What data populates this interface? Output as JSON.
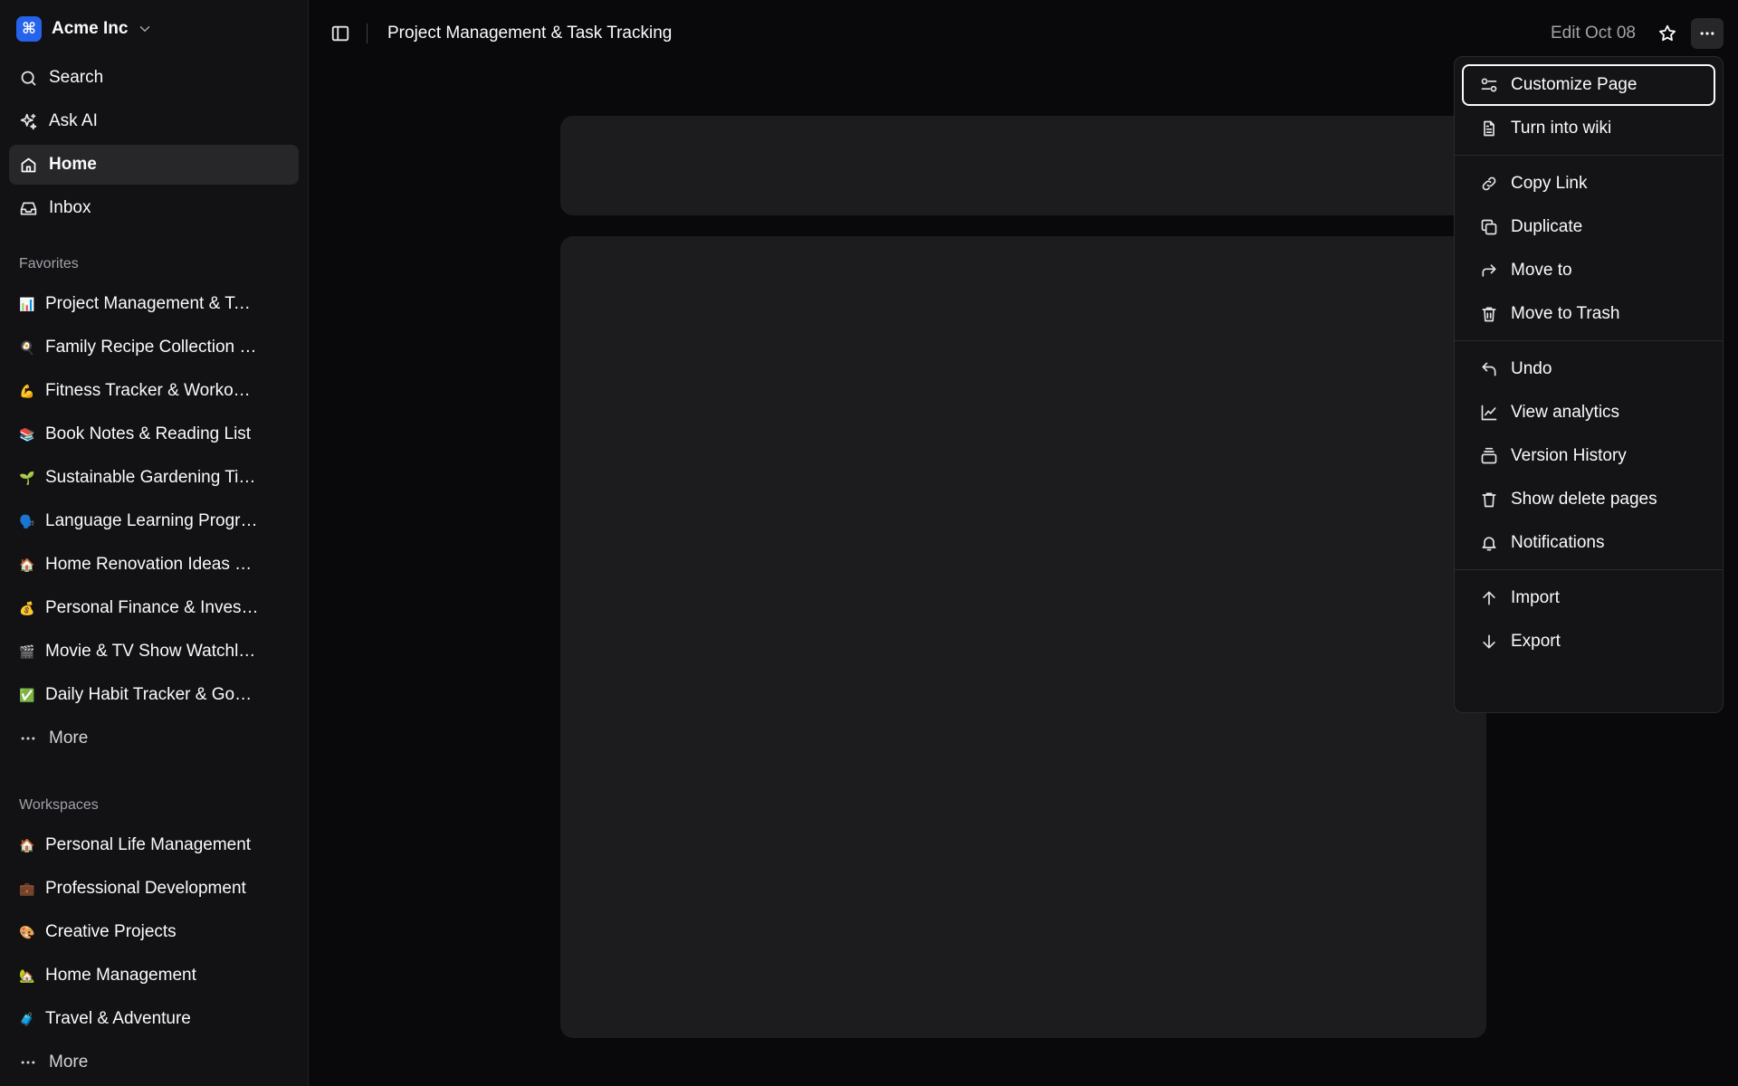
{
  "app": {
    "team_name": "Acme Inc",
    "team_logo_glyph": "⌘",
    "accent": "#2563eb"
  },
  "nav": [
    {
      "label": "Search",
      "icon": "search-icon"
    },
    {
      "label": "Ask AI",
      "icon": "sparkles-icon"
    },
    {
      "label": "Home",
      "icon": "home-icon",
      "active": true
    },
    {
      "label": "Inbox",
      "icon": "inbox-icon"
    }
  ],
  "favorites": {
    "title": "Favorites",
    "items": [
      {
        "emoji": "📊",
        "label": "Project Management & Task Tracking"
      },
      {
        "emoji": "🍳",
        "label": "Family Recipe Collection & Meal Planning"
      },
      {
        "emoji": "💪",
        "label": "Fitness Tracker & Workout Routines"
      },
      {
        "emoji": "📚",
        "label": "Book Notes & Reading List"
      },
      {
        "emoji": "🌱",
        "label": "Sustainable Gardening Tips & Plant Care"
      },
      {
        "emoji": "🗣️",
        "label": "Language Learning Progress & Resources"
      },
      {
        "emoji": "🏠",
        "label": "Home Renovation Ideas & Budget Tracker"
      },
      {
        "emoji": "💰",
        "label": "Personal Finance & Investment Portfolio"
      },
      {
        "emoji": "🎬",
        "label": "Movie & TV Show Watchlist with Reviews"
      },
      {
        "emoji": "✅",
        "label": "Daily Habit Tracker & Goal Setting"
      }
    ],
    "more_label": "More"
  },
  "workspaces": {
    "title": "Workspaces",
    "items": [
      {
        "emoji": "🏠",
        "label": "Personal Life Management"
      },
      {
        "emoji": "💼",
        "label": "Professional Development"
      },
      {
        "emoji": "🎨",
        "label": "Creative Projects"
      },
      {
        "emoji": "🏡",
        "label": "Home Management"
      },
      {
        "emoji": "🧳",
        "label": "Travel & Adventure"
      }
    ],
    "more_label": "More"
  },
  "header": {
    "page_title": "Project Management & Task Tracking",
    "edit_date": "Edit Oct 08"
  },
  "menu": {
    "groups": [
      [
        {
          "label": "Customize Page",
          "icon": "sliders-icon",
          "focused": true
        },
        {
          "label": "Turn into wiki",
          "icon": "file-text-icon"
        }
      ],
      [
        {
          "label": "Copy Link",
          "icon": "link-icon"
        },
        {
          "label": "Duplicate",
          "icon": "copy-icon"
        },
        {
          "label": "Move to",
          "icon": "corner-up-right-icon"
        },
        {
          "label": "Move to Trash",
          "icon": "trash-icon"
        }
      ],
      [
        {
          "label": "Undo",
          "icon": "undo-icon"
        },
        {
          "label": "View analytics",
          "icon": "line-chart-icon"
        },
        {
          "label": "Version History",
          "icon": "gallery-stack-icon"
        },
        {
          "label": "Show delete pages",
          "icon": "trash-outline-icon"
        },
        {
          "label": "Notifications",
          "icon": "bell-icon"
        }
      ],
      [
        {
          "label": "Import",
          "icon": "arrow-up-icon"
        },
        {
          "label": "Export",
          "icon": "arrow-down-icon"
        }
      ]
    ]
  }
}
